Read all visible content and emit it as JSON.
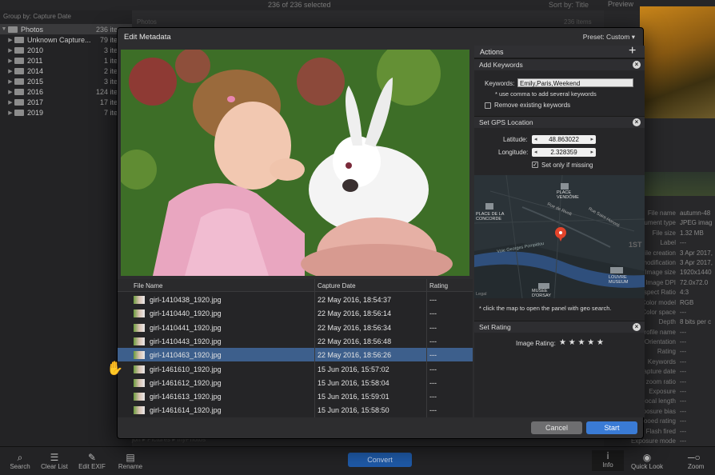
{
  "app": {
    "selection_status": "236 of 236 selected",
    "sort_label": "Sort by: Title",
    "preview_label": "Preview",
    "group_by": "Group by: Capture Date",
    "center_heading": "Photos",
    "center_count": "236 items"
  },
  "sidebar": {
    "items": [
      {
        "label": "Photos",
        "count": "236 ite"
      },
      {
        "label": "Unknown Capture...",
        "count": "79 ite"
      },
      {
        "label": "2010",
        "count": "3 ite"
      },
      {
        "label": "2011",
        "count": "1 ite"
      },
      {
        "label": "2014",
        "count": "2 ite"
      },
      {
        "label": "2015",
        "count": "3 ite"
      },
      {
        "label": "2016",
        "count": "124 ite"
      },
      {
        "label": "2017",
        "count": "17 ite"
      },
      {
        "label": "2019",
        "count": "7 ite"
      }
    ]
  },
  "properties": [
    {
      "k": "File name",
      "v": "autumn-48"
    },
    {
      "k": "ument type",
      "v": "JPEG imag"
    },
    {
      "k": "File size",
      "v": "1.32 MB"
    },
    {
      "k": "Label",
      "v": "---"
    },
    {
      "k": "File creation",
      "v": "3 Apr 2017,"
    },
    {
      "k": "modification",
      "v": "3 Apr 2017,"
    },
    {
      "k": "Image size",
      "v": "1920x1440"
    },
    {
      "k": "Image DPI",
      "v": "72.0x72.0"
    },
    {
      "k": "Aspect Ratio",
      "v": "4:3"
    },
    {
      "k": "Color model",
      "v": "RGB"
    },
    {
      "k": "Color space",
      "v": "---"
    },
    {
      "k": "Depth",
      "v": "8 bits per c"
    },
    {
      "k": "Profile name",
      "v": "---"
    },
    {
      "k": "Orientation",
      "v": "---"
    },
    {
      "k": "Rating",
      "v": "---"
    },
    {
      "k": "Keywords",
      "v": "---"
    },
    {
      "k": "Capture date",
      "v": "---"
    },
    {
      "k": "al zoom ratio",
      "v": "---"
    },
    {
      "k": "Exposure",
      "v": "---"
    },
    {
      "k": "Focal length",
      "v": "---"
    },
    {
      "k": "xposure bias",
      "v": "---"
    },
    {
      "k": "hooed rating",
      "v": "---"
    },
    {
      "k": "Flash fired",
      "v": "---"
    },
    {
      "k": "Exposure mode",
      "v": "---"
    }
  ],
  "breadcrumb": "jon ▸ Pictures ▸ myPhotos",
  "toolbar": {
    "search": "Search",
    "clear": "Clear List",
    "edit_exif": "Edit EXIF",
    "rename": "Rename",
    "convert": "Convert",
    "info": "Info",
    "quick_look": "Quick Look",
    "zoom": "Zoom"
  },
  "dialog": {
    "title": "Edit Metadata",
    "preset": "Preset: Custom",
    "columns": {
      "file_name": "File Name",
      "capture_date": "Capture Date",
      "rating": "Rating"
    },
    "files": [
      {
        "name": "girl-1410438_1920.jpg",
        "date": "22 May 2016, 18:54:37",
        "rating": "---"
      },
      {
        "name": "girl-1410440_1920.jpg",
        "date": "22 May 2016, 18:56:14",
        "rating": "---"
      },
      {
        "name": "girl-1410441_1920.jpg",
        "date": "22 May 2016, 18:56:34",
        "rating": "---"
      },
      {
        "name": "girl-1410443_1920.jpg",
        "date": "22 May 2016, 18:56:48",
        "rating": "---"
      },
      {
        "name": "girl-1410463_1920.jpg",
        "date": "22 May 2016, 18:56:26",
        "rating": "---"
      },
      {
        "name": "girl-1461610_1920.jpg",
        "date": "15 Jun 2016, 15:57:02",
        "rating": "---"
      },
      {
        "name": "girl-1461612_1920.jpg",
        "date": "15 Jun 2016, 15:58:04",
        "rating": "---"
      },
      {
        "name": "girl-1461613_1920.jpg",
        "date": "15 Jun 2016, 15:59:01",
        "rating": "---"
      },
      {
        "name": "girl-1461614_1920.jpg",
        "date": "15 Jun 2016, 15:58:50",
        "rating": "---"
      }
    ],
    "selected_index": 4,
    "actions": {
      "header": "Actions",
      "add_keywords": {
        "title": "Add Keywords",
        "field_label": "Keywords:",
        "value": "Emily,Paris,Weekend",
        "hint": "* use comma to add several keywords",
        "remove_label": "Remove existing keywords",
        "remove_checked": false
      },
      "gps": {
        "title": "Set GPS Location",
        "lat_label": "Latitude:",
        "lat_value": "48.863022",
        "lon_label": "Longitude:",
        "lon_value": "2.328359",
        "only_missing_label": "Set only if missing",
        "only_missing_checked": true,
        "hint": "* click the map to open the panel with geo search.",
        "map_labels": {
          "vendome": "PLACE VENDÔME",
          "concorde": "PLACE DE LA CONCORDE",
          "rivoli": "Rue de Rivoli",
          "st_honore": "Rue Saint-Honoré",
          "voie": "Voie Georges Pompidou",
          "louvre": "LOUVRE MUSEUM",
          "orsay": "MUSÉE D'ORSAY",
          "arr": "1ST",
          "legal": "Legal"
        }
      },
      "rating": {
        "title": "Set Rating",
        "label": "Image Rating:",
        "stars": "★ ★ ★ ★ ★"
      }
    },
    "cancel": "Cancel",
    "start": "Start"
  },
  "colors": {
    "accent": "#3a7bd5",
    "selection": "#3d5f8c",
    "pin": "#e3442b"
  }
}
